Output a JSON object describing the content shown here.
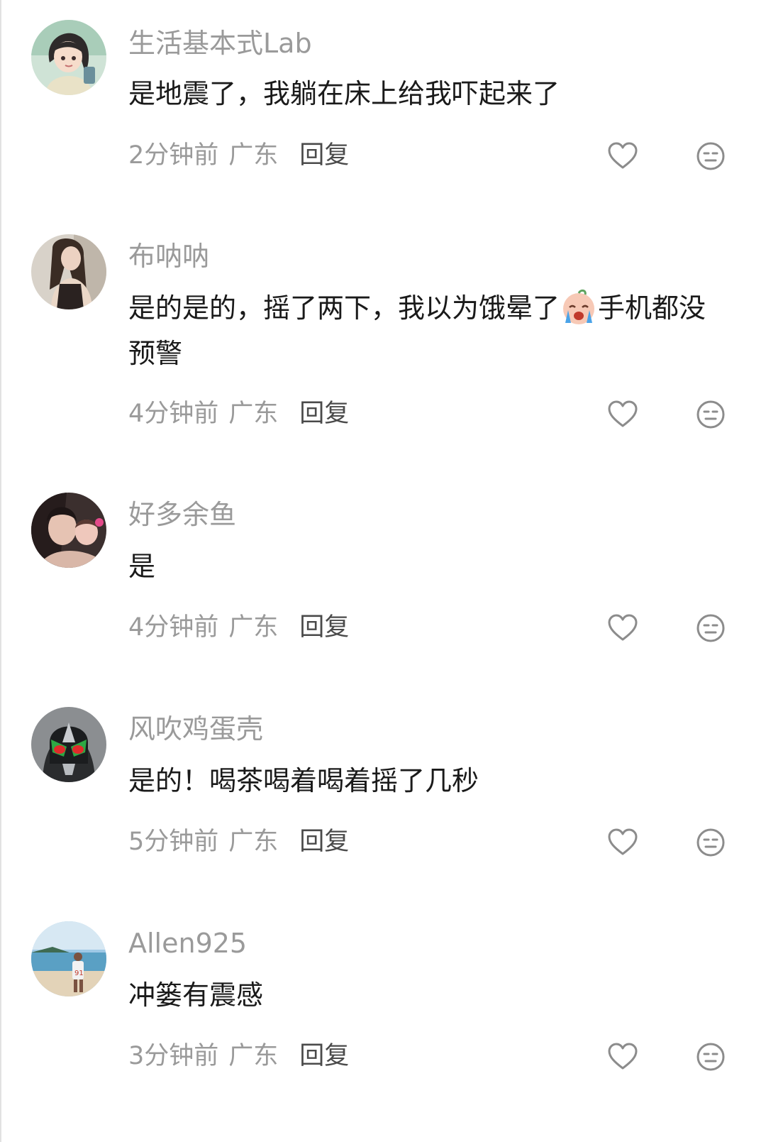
{
  "comments": [
    {
      "username": "生活基本式Lab",
      "text": "是地震了，我躺在床上给我吓起来了",
      "time": "2分钟前",
      "region": "广东",
      "reply_label": "回复",
      "avatar": "cartoon-girl-avatar"
    },
    {
      "username": "布呐呐",
      "text_before_emoji": "是的是的，摇了两下，我以为饿晕了",
      "emoji": "crying-face-emoji",
      "text_after_emoji": "手机都没预警",
      "time": "4分钟前",
      "region": "广东",
      "reply_label": "回复",
      "avatar": "girl-photo-avatar"
    },
    {
      "username": "好多余鱼",
      "text": "是",
      "time": "4分钟前",
      "region": "广东",
      "reply_label": "回复",
      "avatar": "selfie-photo-avatar"
    },
    {
      "username": "风吹鸡蛋壳",
      "text": "是的！喝茶喝着喝着摇了几秒",
      "time": "5分钟前",
      "region": "广东",
      "reply_label": "回复",
      "avatar": "masked-hero-avatar"
    },
    {
      "username": "Allen925",
      "text": "冲篓有震感",
      "time": "3分钟前",
      "region": "广东",
      "reply_label": "回复",
      "avatar": "beach-photo-avatar"
    }
  ],
  "icons": {
    "like": "heart-outline-icon",
    "dislike": "neutral-face-icon"
  },
  "colors": {
    "username": "#9a9a9a",
    "text": "#1a1a1a",
    "meta": "#9a9a9a",
    "reply": "#4a4a4a",
    "icon": "#8c8c8c"
  }
}
